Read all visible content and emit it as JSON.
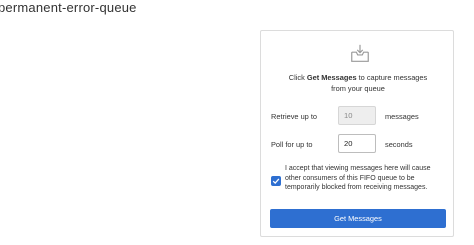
{
  "queue": {
    "name": "permanent-error-queue"
  },
  "panel": {
    "icon": "inbox-download-icon",
    "intro_prefix": "Click ",
    "intro_bold": "Get Messages",
    "intro_suffix": " to capture messages from your queue",
    "retrieve": {
      "label": "Retrieve up to",
      "value": "10",
      "unit": "messages",
      "disabled": true
    },
    "poll": {
      "label": "Poll for up to",
      "value": "20",
      "unit": "seconds",
      "disabled": false
    },
    "accept": {
      "checked": true,
      "text": "I accept that viewing messages here will cause other consumers of this FIFO queue to be temporarily blocked from receiving messages."
    },
    "button_label": "Get Messages",
    "accent_color": "#2e6fd1"
  }
}
